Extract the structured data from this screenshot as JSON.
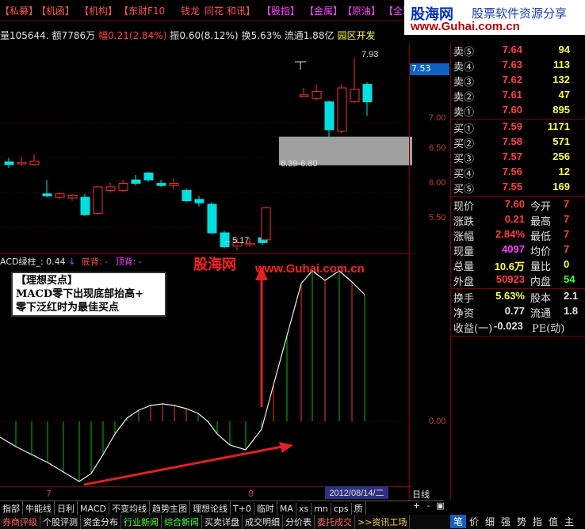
{
  "top_menu": [
    {
      "label": "【私募】",
      "color": "red"
    },
    {
      "label": "【机函】",
      "color": "red"
    },
    {
      "label": "【机构】",
      "color": "red"
    },
    {
      "label": "【东财F10",
      "color": "red"
    },
    {
      "label": "钱龙",
      "color": "red"
    },
    {
      "label": "同花",
      "color": "red"
    },
    {
      "label": "和讯】",
      "color": "red"
    },
    {
      "label": "【股指】",
      "color": "mag"
    },
    {
      "label": "【金属】",
      "color": "mag"
    },
    {
      "label": "【原油】",
      "color": "mag"
    },
    {
      "label": "【全球",
      "color": "mag"
    }
  ],
  "logo": {
    "name": "股海网",
    "slogan": "股票软件资源分享",
    "url": "www.Guhai.com.cn"
  },
  "infobar": {
    "volume_prefix": "量105644.",
    "amount": "额7786万",
    "change": "幅0.21(2.84%)",
    "amplitude": "振0.60(8.12%)",
    "turnover": "换5.63%",
    "float": "流通1.88亿",
    "sector": "园区开发"
  },
  "main_chart": {
    "y_axis_labels": [
      "7.50",
      "7.00",
      "6.50",
      "6.00",
      "5.50"
    ],
    "current_price": "7.53",
    "high_label": "7.93",
    "low_label": "5.17",
    "range_label": "6.39-6.80"
  },
  "macd": {
    "header_name": "ACD绿柱_: 0.44",
    "header_bottom": "底背: -",
    "header_top": "顶背: -",
    "zero_label": "0.00"
  },
  "watermark": {
    "cn": "股海网",
    "url": "www.Guhai.com.cn"
  },
  "annotation": {
    "title": "【理想买点】",
    "line1": "MACD零下出现底部抬高+",
    "line2": "零下泛红时为最佳买点"
  },
  "x_axis": {
    "m1": "7",
    "m2": "8",
    "date": "2012/08/14/二",
    "period": "日线"
  },
  "order_book": {
    "sells": [
      {
        "label": "卖⑤",
        "price": "7.64",
        "vol": "94"
      },
      {
        "label": "卖④",
        "price": "7.63",
        "vol": "113"
      },
      {
        "label": "卖③",
        "price": "7.62",
        "vol": "132"
      },
      {
        "label": "卖②",
        "price": "7.61",
        "vol": "47"
      },
      {
        "label": "卖①",
        "price": "7.60",
        "vol": "895"
      }
    ],
    "buys": [
      {
        "label": "买①",
        "price": "7.59",
        "vol": "1171"
      },
      {
        "label": "买②",
        "price": "7.58",
        "vol": "571"
      },
      {
        "label": "买③",
        "price": "7.57",
        "vol": "256"
      },
      {
        "label": "买④",
        "price": "7.56",
        "vol": "12"
      },
      {
        "label": "买⑤",
        "price": "7.55",
        "vol": "169"
      }
    ]
  },
  "stats": {
    "xianjia_lbl": "现价",
    "xianjia": "7.60",
    "jinkai_lbl": "今开",
    "jinkai": "7",
    "zhangdie_lbl": "涨跌",
    "zhangdie": "0.21",
    "zuigao_lbl": "最高",
    "zuigao": "7",
    "zhangfu_lbl": "涨幅",
    "zhangfu": "2.84%",
    "zuidi_lbl": "最低",
    "zuidi": "7",
    "xianliang_lbl": "现量",
    "xianliang": "4097",
    "junjia_lbl": "均价",
    "junjia": "7",
    "zongliang_lbl": "总量",
    "zongliang": "10.6万",
    "liangbi_lbl": "量比",
    "liangbi": "0",
    "waipan_lbl": "外盘",
    "waipan": "50923",
    "neipan_lbl": "内盘",
    "neipan": "54",
    "huanshou_lbl": "换手",
    "huanshou": "5.63%",
    "guben_lbl": "股本",
    "guben": "2.1",
    "jingzi_lbl": "净资",
    "jingzi": "0.77",
    "liutong_lbl": "流通",
    "liutong": "1.8",
    "shouyi_lbl": "收益(一)",
    "shouyi": "-0.023",
    "pe_lbl": "PE(动)"
  },
  "toolbar1": [
    "指部",
    "牛能线",
    "日利",
    "MACD",
    "不变均线",
    "趋势主图",
    "理想论线",
    "T+0",
    "临时",
    "MA",
    "xs",
    "mn",
    "cps",
    "质"
  ],
  "toolbar1_right": [
    "+",
    "-",
    "▣"
  ],
  "toolbar2": [
    {
      "label": "券商评级",
      "color": "#ff6060"
    },
    {
      "label": "个股评测",
      "color": "#e0e0e0"
    },
    {
      "label": "资金分布",
      "color": "#e0e0e0"
    },
    {
      "label": "行业新闻",
      "color": "#40ff40"
    },
    {
      "label": "综合新闻",
      "color": "#40ff40"
    },
    {
      "label": "买卖详盘",
      "color": "#e0e0e0"
    },
    {
      "label": "成交明细",
      "color": "#e0e0e0"
    },
    {
      "label": "分价表",
      "color": "#e0e0e0"
    },
    {
      "label": "委托成交",
      "color": "#ff6060"
    },
    {
      "label": ">>资讯工场",
      "color": "#ffd040"
    }
  ],
  "toolbar3": [
    "笔",
    "价",
    "细",
    "强",
    "势",
    "指",
    "值",
    "主"
  ]
}
